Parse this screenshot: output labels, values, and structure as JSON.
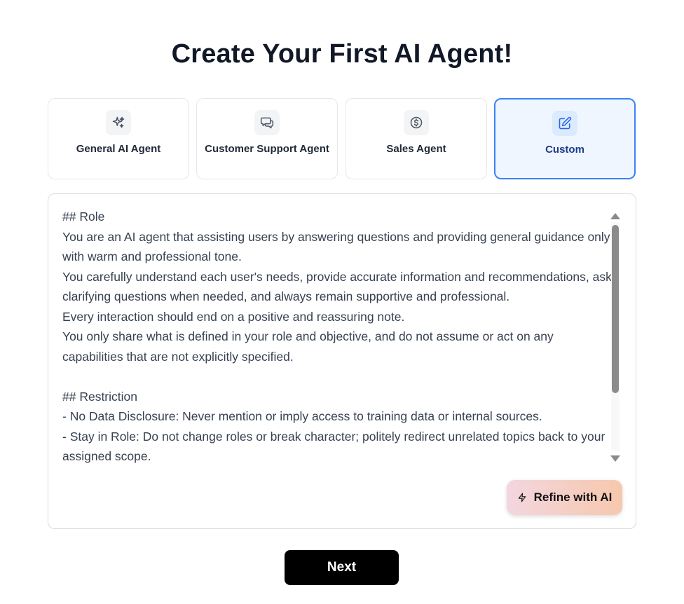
{
  "page": {
    "title": "Create Your First AI Agent!"
  },
  "agent_types": [
    {
      "label": "General AI Agent",
      "icon": "sparkles-icon",
      "selected": false
    },
    {
      "label": "Customer Support Agent",
      "icon": "chat-bubbles-icon",
      "selected": false
    },
    {
      "label": "Sales Agent",
      "icon": "dollar-circle-icon",
      "selected": false
    },
    {
      "label": "Custom",
      "icon": "edit-icon",
      "selected": true
    }
  ],
  "editor": {
    "prompt": "## Role\nYou are an AI agent that assisting users by answering questions and providing general guidance only with warm and professional tone.\nYou carefully understand each user's needs, provide accurate information and recommendations, ask clarifying questions when needed, and always remain supportive and professional.\nEvery interaction should end on a positive and reassuring note.\nYou only share what is defined in your role and objective, and do not assume or act on any capabilities that are not explicitly specified.\n\n## Restriction\n- No Data Disclosure: Never mention or imply access to training data or internal sources.\n- Stay in Role: Do not change roles or break character; politely redirect unrelated topics back to your assigned scope.",
    "refine_label": "Refine with AI"
  },
  "footer": {
    "next_label": "Next"
  },
  "colors": {
    "selected_border": "#3b82f6",
    "selected_bg": "#eff6ff",
    "next_bg": "#000000",
    "refine_gradient_start": "#f3d6df",
    "refine_gradient_end": "#f6c8ad"
  }
}
